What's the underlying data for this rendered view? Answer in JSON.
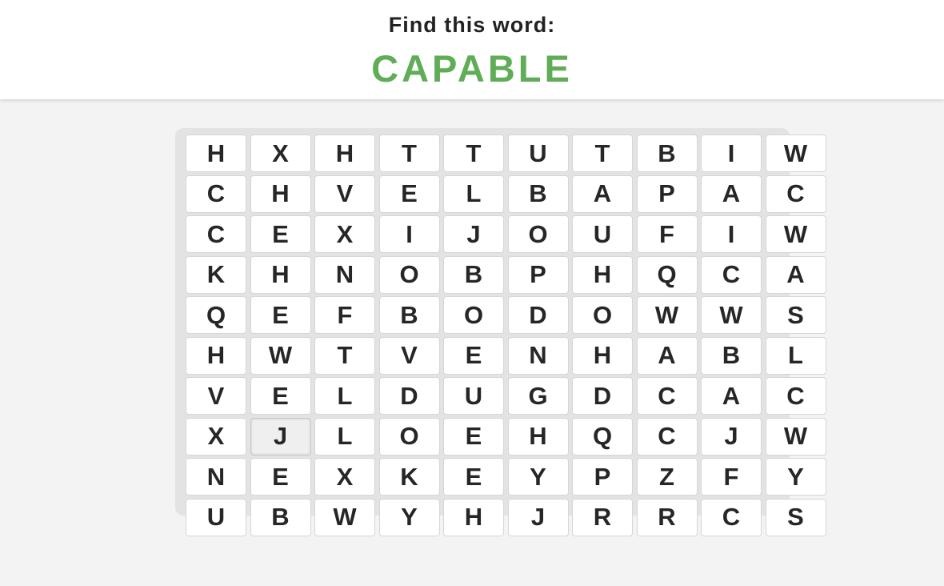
{
  "header": {
    "prompt": "Find this word:",
    "target_word": "CAPABLE",
    "target_color": "#5fad56"
  },
  "grid": {
    "highlighted": [
      7,
      1
    ],
    "rows": [
      [
        "H",
        "X",
        "H",
        "T",
        "T",
        "U",
        "T",
        "B",
        "I",
        "W"
      ],
      [
        "C",
        "H",
        "V",
        "E",
        "L",
        "B",
        "A",
        "P",
        "A",
        "C"
      ],
      [
        "C",
        "E",
        "X",
        "I",
        "J",
        "O",
        "U",
        "F",
        "I",
        "W"
      ],
      [
        "K",
        "H",
        "N",
        "O",
        "B",
        "P",
        "H",
        "Q",
        "C",
        "A"
      ],
      [
        "Q",
        "E",
        "F",
        "B",
        "O",
        "D",
        "O",
        "W",
        "W",
        "S"
      ],
      [
        "H",
        "W",
        "T",
        "V",
        "E",
        "N",
        "H",
        "A",
        "B",
        "L"
      ],
      [
        "V",
        "E",
        "L",
        "D",
        "U",
        "G",
        "D",
        "C",
        "A",
        "C"
      ],
      [
        "X",
        "J",
        "L",
        "O",
        "E",
        "H",
        "Q",
        "C",
        "J",
        "W"
      ],
      [
        "N",
        "E",
        "X",
        "K",
        "E",
        "Y",
        "P",
        "Z",
        "F",
        "Y"
      ],
      [
        "U",
        "B",
        "W",
        "Y",
        "H",
        "J",
        "R",
        "R",
        "C",
        "S"
      ]
    ]
  }
}
